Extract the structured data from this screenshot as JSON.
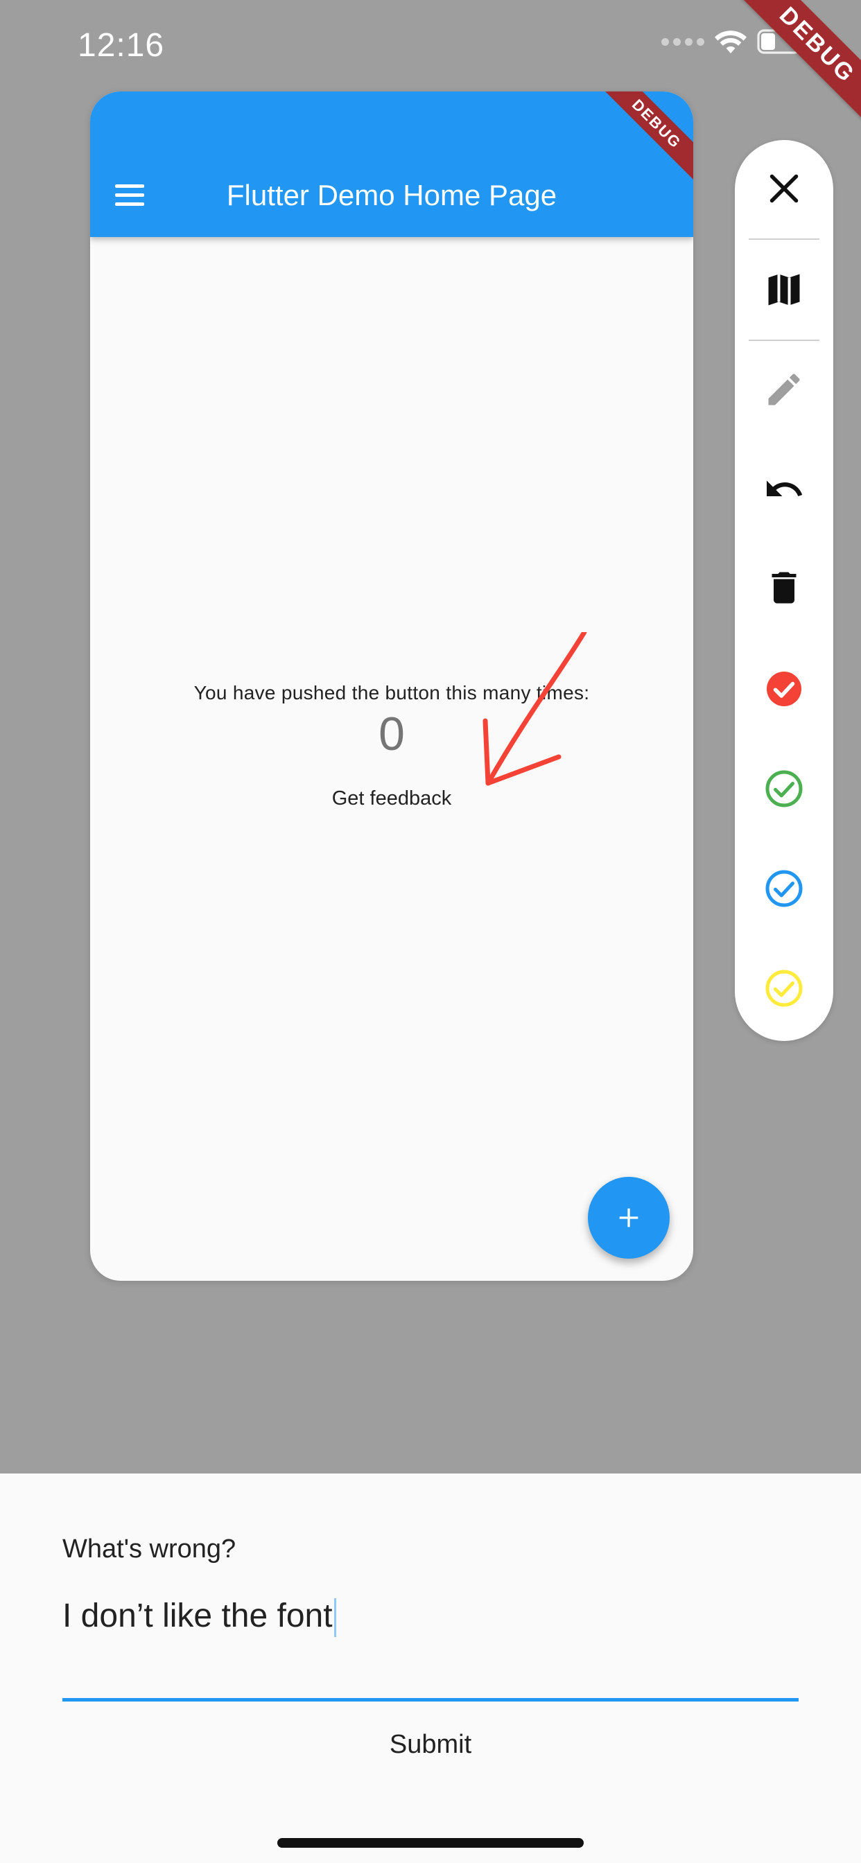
{
  "status_bar": {
    "time": "12:16"
  },
  "debug_banner": "DEBUG",
  "app": {
    "title": "Flutter Demo Home Page",
    "debug_banner": "DEBUG",
    "pushed_text": "You have pushed the button this many times:",
    "counter": "0",
    "feedback_button": "Get feedback",
    "fab_icon": "add-icon"
  },
  "toolbar": {
    "items": [
      "close-icon",
      "map-icon",
      "pencil-icon",
      "undo-icon",
      "delete-icon",
      "red-check",
      "green-check",
      "blue-check",
      "yellow-check"
    ],
    "colors": {
      "red": "#f44336",
      "green": "#4caf50",
      "blue": "#2196f3",
      "yellow": "#ffeb3b"
    }
  },
  "feedback_panel": {
    "label": "What's wrong?",
    "input_value": "I don’t like the font",
    "submit_label": "Submit"
  },
  "colors": {
    "accent": "#2196f3",
    "drawing": "#f44336"
  }
}
